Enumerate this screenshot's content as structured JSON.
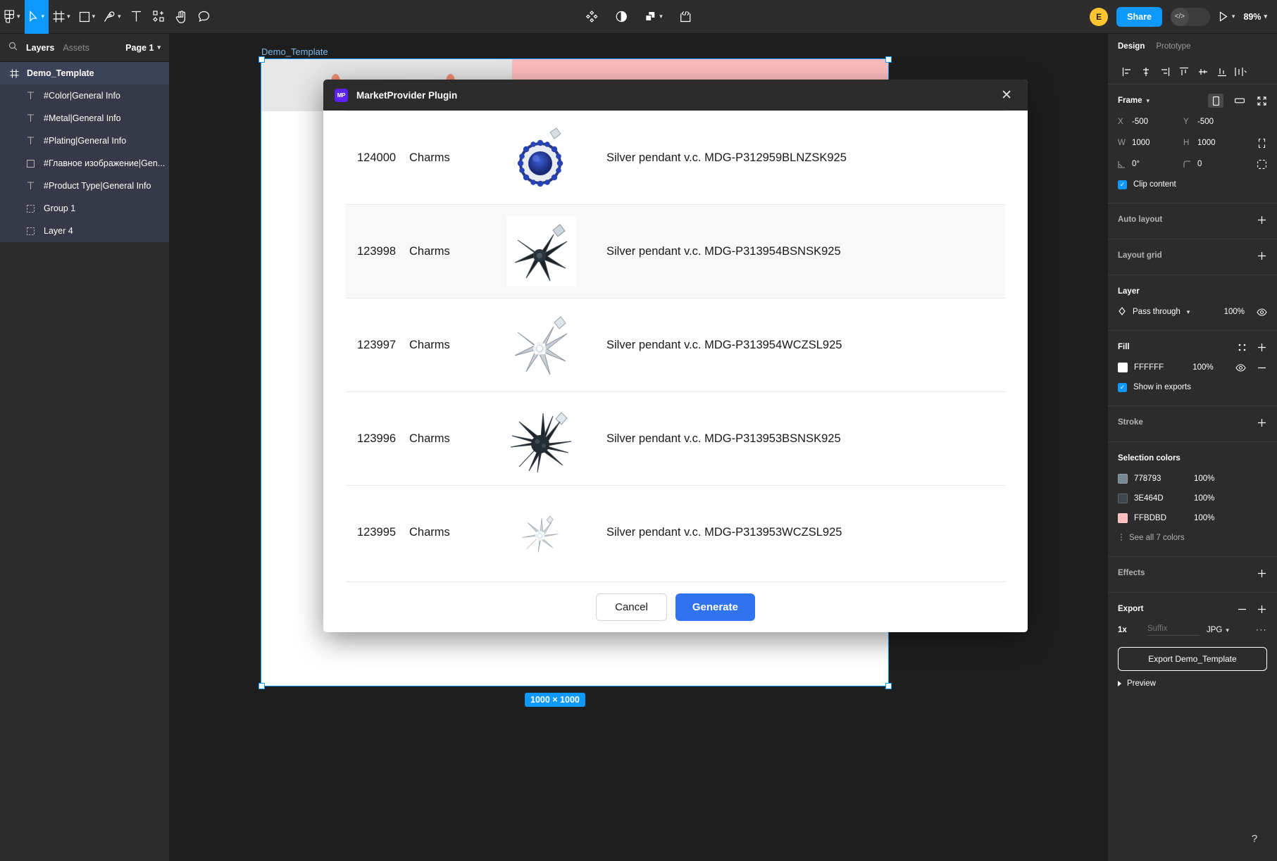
{
  "toolbar": {
    "tools": [
      {
        "name": "figma-logo-icon",
        "caret": true
      },
      {
        "name": "move-tool-icon",
        "caret": true,
        "active": true
      },
      {
        "name": "frame-tool-icon",
        "caret": true
      },
      {
        "name": "shape-tool-icon",
        "caret": true
      },
      {
        "name": "pen-tool-icon",
        "caret": true
      },
      {
        "name": "text-tool-icon",
        "caret": false
      },
      {
        "name": "components-tool-icon",
        "caret": false
      },
      {
        "name": "hand-tool-icon",
        "caret": false
      },
      {
        "name": "comment-tool-icon",
        "caret": false
      }
    ],
    "center": [
      {
        "name": "plugin-actions-icon"
      },
      {
        "name": "contrast-icon"
      },
      {
        "name": "boolean-group-icon",
        "caret": true
      },
      {
        "name": "dev-resources-icon"
      }
    ],
    "avatar_initial": "E",
    "share_label": "Share",
    "code_icon": "</>",
    "present_icon": "play-icon",
    "zoom_label": "89%"
  },
  "sidebar": {
    "search_icon": "search-icon",
    "tabs": [
      {
        "label": "Layers",
        "active": true
      },
      {
        "label": "Assets",
        "active": false
      }
    ],
    "page_label": "Page 1",
    "layers": [
      {
        "label": "Demo_Template",
        "icon": "frame-icon",
        "selected": true,
        "child": false
      },
      {
        "label": "#Color|General Info",
        "icon": "text-icon",
        "selected": false,
        "child": true
      },
      {
        "label": "#Metal|General Info",
        "icon": "text-icon",
        "selected": false,
        "child": true
      },
      {
        "label": "#Plating|General Info",
        "icon": "text-icon",
        "selected": false,
        "child": true
      },
      {
        "label": "#Главное изображение|Gen...",
        "icon": "rect-icon",
        "selected": false,
        "child": true
      },
      {
        "label": "#Product Type|General Info",
        "icon": "text-icon",
        "selected": false,
        "child": true
      },
      {
        "label": "Group 1",
        "icon": "group-icon",
        "selected": false,
        "child": true
      },
      {
        "label": "Layer 4",
        "icon": "group-icon",
        "selected": false,
        "child": true
      }
    ]
  },
  "canvas": {
    "frame_label": "Demo_Template",
    "size_badge": "1000 × 1000"
  },
  "modal": {
    "plugin_icon_text": "MP",
    "title": "MarketProvider Plugin",
    "close_icon": "close-icon",
    "rows": [
      {
        "id": "124000",
        "category": "Charms",
        "thumb": "pendant-blue-round",
        "name": "Silver pendant v.c. MDG-P312959BLNZSK925",
        "alt": false
      },
      {
        "id": "123998",
        "category": "Charms",
        "thumb": "pendant-star-black",
        "name": "Silver pendant v.c. MDG-P313954BSNSK925",
        "alt": true
      },
      {
        "id": "123997",
        "category": "Charms",
        "thumb": "pendant-star-white",
        "name": "Silver pendant v.c. MDG-P313954WCZSL925",
        "alt": false
      },
      {
        "id": "123996",
        "category": "Charms",
        "thumb": "pendant-burst-black",
        "name": "Silver pendant v.c. MDG-P313953BSNSK925",
        "alt": false
      },
      {
        "id": "123995",
        "category": "Charms",
        "thumb": "pendant-burst-white",
        "name": "Silver pendant v.c. MDG-P313953WCZSL925",
        "alt": false
      }
    ],
    "cancel_label": "Cancel",
    "generate_label": "Generate"
  },
  "right_panel": {
    "tabs": [
      {
        "label": "Design",
        "active": true
      },
      {
        "label": "Prototype",
        "active": false
      }
    ],
    "align_icons": [
      "align-left-icon",
      "align-horizontal-center-icon",
      "align-right-icon",
      "align-top-icon",
      "align-vertical-center-icon",
      "align-bottom-icon",
      "distribute-icon"
    ],
    "frame": {
      "title": "Frame",
      "x_label": "X",
      "x_value": "-500",
      "y_label": "Y",
      "y_value": "-500",
      "w_label": "W",
      "w_value": "1000",
      "h_label": "H",
      "h_value": "1000",
      "rotation_value": "0°",
      "corner_value": "0",
      "clip_label": "Clip content",
      "clip_checked": true
    },
    "auto_layout": {
      "title": "Auto layout",
      "add_icon": "plus-icon"
    },
    "layout_grid": {
      "title": "Layout grid",
      "add_icon": "plus-icon"
    },
    "layer": {
      "title": "Layer",
      "blend_mode": "Pass through",
      "opacity": "100%",
      "visibility_icon": "eye-icon"
    },
    "fill": {
      "title": "Fill",
      "hex": "FFFFFF",
      "opacity": "100%",
      "show_in_exports_label": "Show in exports",
      "show_in_exports_checked": true,
      "color": "#FFFFFF"
    },
    "stroke": {
      "title": "Stroke",
      "add_icon": "plus-icon"
    },
    "selection_colors": {
      "title": "Selection colors",
      "items": [
        {
          "hex": "778793",
          "opacity": "100%",
          "color": "#778793"
        },
        {
          "hex": "3E464D",
          "opacity": "100%",
          "color": "#3E464D"
        },
        {
          "hex": "FFBDBD",
          "opacity": "100%",
          "color": "#FFBDBD"
        }
      ],
      "see_all_label": "See all 7 colors"
    },
    "effects": {
      "title": "Effects",
      "add_icon": "plus-icon"
    },
    "export": {
      "title": "Export",
      "scale": "1x",
      "suffix_placeholder": "Suffix",
      "format": "JPG",
      "more_icon": "···",
      "button_label": "Export Demo_Template",
      "preview_label": "Preview"
    }
  },
  "help": {
    "icon": "question-mark-icon",
    "label": "?"
  }
}
